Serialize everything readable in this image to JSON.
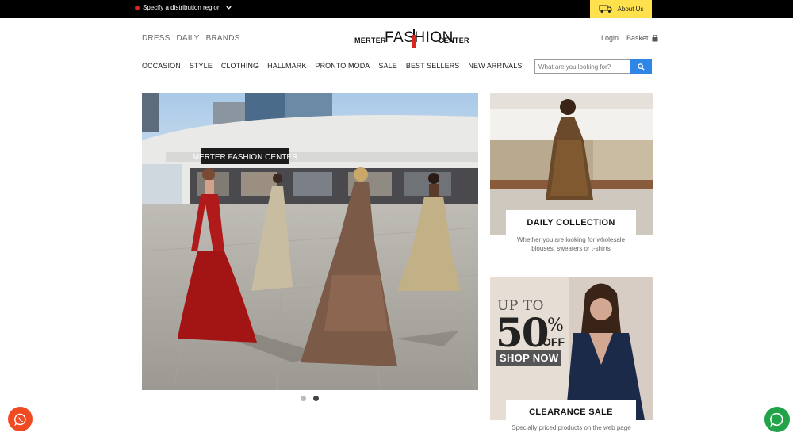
{
  "topbar": {
    "region_label": "Specify a distribution region",
    "about_label": "About Us"
  },
  "header": {
    "category_links": [
      "DRESS",
      "DAILY",
      "BRANDS"
    ],
    "logo": {
      "left": "MERTER",
      "main": "FASHION",
      "right": "CENTER"
    },
    "login_label": "Login",
    "basket_label": "Basket"
  },
  "nav": {
    "items": [
      "OCCASION",
      "STYLE",
      "CLOTHING",
      "HALLMARK",
      "PRONTO MODA",
      "SALE",
      "BEST SELLERS",
      "NEW ARRIVALS"
    ]
  },
  "search": {
    "placeholder": "What are you looking for?"
  },
  "hero": {
    "sign_text": "MERTER FASHION CENTER",
    "slides": 2,
    "active_slide": 2
  },
  "cards": {
    "daily": {
      "title": "DAILY COLLECTION",
      "description": "Whether you are looking for wholesale blouses, sweaters or t-shirts"
    },
    "clearance": {
      "promo_up": "UP TO",
      "promo_num": "50",
      "promo_pct": "%",
      "promo_off": "OFF",
      "promo_shop": "SHOP NOW",
      "title": "CLEARANCE SALE",
      "description": "Specially priced products on the web page"
    }
  },
  "colors": {
    "topbar": "#000000",
    "about_bg": "#ffe14d",
    "search_button": "#2f86e6",
    "whatsapp_left": "#f04a23",
    "whatsapp_right": "#22a349"
  },
  "icons": {
    "region": "location-dot-icon",
    "chevron": "chevron-down-icon",
    "about": "truck-icon",
    "basket": "basket-icon",
    "search": "search-icon",
    "chat_left": "whatsapp-icon",
    "chat_right": "whatsapp-icon"
  }
}
